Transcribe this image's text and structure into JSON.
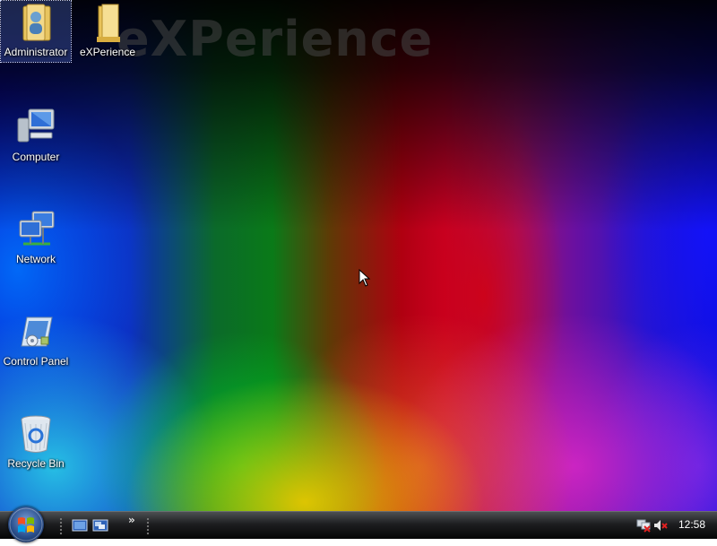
{
  "desktop": {
    "watermark": "eXPerience",
    "icons": [
      {
        "label": "Administrator",
        "icon": "user-folder-icon"
      },
      {
        "label": "eXPerience",
        "icon": "folder-icon"
      },
      {
        "label": "Computer",
        "icon": "computer-icon"
      },
      {
        "label": "Network",
        "icon": "network-icon"
      },
      {
        "label": "Control Panel",
        "icon": "control-panel-icon"
      },
      {
        "label": "Recycle Bin",
        "icon": "recycle-bin-icon"
      }
    ]
  },
  "taskbar": {
    "start_icon": "windows-logo-icon",
    "quick_launch": [
      {
        "icon": "show-desktop-icon"
      },
      {
        "icon": "switch-windows-icon"
      }
    ],
    "overflow": "»",
    "tray": {
      "network_icon": "network-disconnected-icon",
      "volume_icon": "volume-muted-icon",
      "clock": "12:58"
    }
  },
  "colors": {
    "taskbar_top": "#4c4f52",
    "taskbar_bottom": "#050505",
    "label_text": "#ffffff"
  }
}
